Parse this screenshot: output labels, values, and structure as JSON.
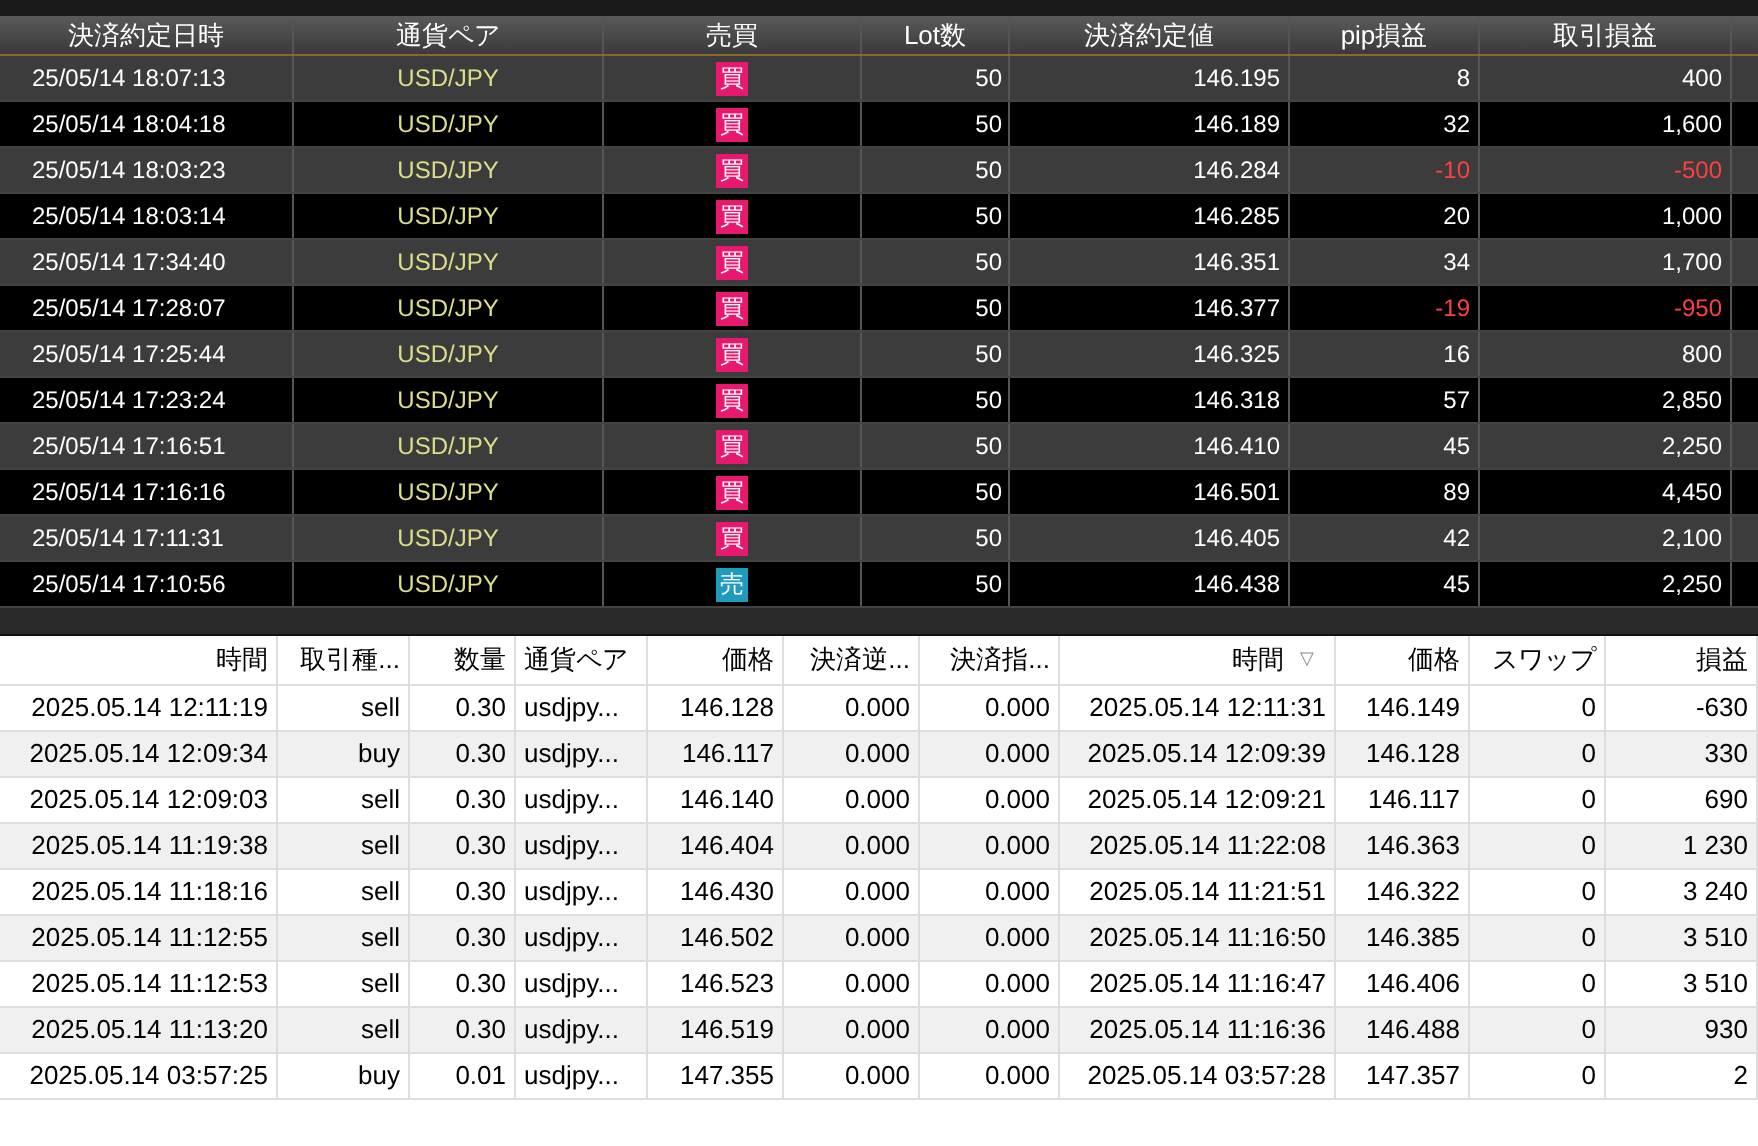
{
  "settlements": {
    "columns": [
      "決済約定日時",
      "通貨ペア",
      "売買",
      "Lot数",
      "決済約定値",
      "pip損益",
      "取引損益"
    ],
    "rows": [
      {
        "time": "25/05/14 18:07:13",
        "pair": "USD/JPY",
        "side": {
          "kind": "buy",
          "label": "買"
        },
        "lots": "50",
        "price": "146.195",
        "pips": "8",
        "profit": "400",
        "loss": false
      },
      {
        "time": "25/05/14 18:04:18",
        "pair": "USD/JPY",
        "side": {
          "kind": "buy",
          "label": "買"
        },
        "lots": "50",
        "price": "146.189",
        "pips": "32",
        "profit": "1,600",
        "loss": false
      },
      {
        "time": "25/05/14 18:03:23",
        "pair": "USD/JPY",
        "side": {
          "kind": "buy",
          "label": "買"
        },
        "lots": "50",
        "price": "146.284",
        "pips": "-10",
        "profit": "-500",
        "loss": true
      },
      {
        "time": "25/05/14 18:03:14",
        "pair": "USD/JPY",
        "side": {
          "kind": "buy",
          "label": "買"
        },
        "lots": "50",
        "price": "146.285",
        "pips": "20",
        "profit": "1,000",
        "loss": false
      },
      {
        "time": "25/05/14 17:34:40",
        "pair": "USD/JPY",
        "side": {
          "kind": "buy",
          "label": "買"
        },
        "lots": "50",
        "price": "146.351",
        "pips": "34",
        "profit": "1,700",
        "loss": false
      },
      {
        "time": "25/05/14 17:28:07",
        "pair": "USD/JPY",
        "side": {
          "kind": "buy",
          "label": "買"
        },
        "lots": "50",
        "price": "146.377",
        "pips": "-19",
        "profit": "-950",
        "loss": true
      },
      {
        "time": "25/05/14 17:25:44",
        "pair": "USD/JPY",
        "side": {
          "kind": "buy",
          "label": "買"
        },
        "lots": "50",
        "price": "146.325",
        "pips": "16",
        "profit": "800",
        "loss": false
      },
      {
        "time": "25/05/14 17:23:24",
        "pair": "USD/JPY",
        "side": {
          "kind": "buy",
          "label": "買"
        },
        "lots": "50",
        "price": "146.318",
        "pips": "57",
        "profit": "2,850",
        "loss": false
      },
      {
        "time": "25/05/14 17:16:51",
        "pair": "USD/JPY",
        "side": {
          "kind": "buy",
          "label": "買"
        },
        "lots": "50",
        "price": "146.410",
        "pips": "45",
        "profit": "2,250",
        "loss": false
      },
      {
        "time": "25/05/14 17:16:16",
        "pair": "USD/JPY",
        "side": {
          "kind": "buy",
          "label": "買"
        },
        "lots": "50",
        "price": "146.501",
        "pips": "89",
        "profit": "4,450",
        "loss": false
      },
      {
        "time": "25/05/14 17:11:31",
        "pair": "USD/JPY",
        "side": {
          "kind": "buy",
          "label": "買"
        },
        "lots": "50",
        "price": "146.405",
        "pips": "42",
        "profit": "2,100",
        "loss": false
      },
      {
        "time": "25/05/14 17:10:56",
        "pair": "USD/JPY",
        "side": {
          "kind": "sell",
          "label": "売"
        },
        "lots": "50",
        "price": "146.438",
        "pips": "45",
        "profit": "2,250",
        "loss": false
      }
    ]
  },
  "history": {
    "columns": [
      {
        "label": "時間"
      },
      {
        "label": "取引種..."
      },
      {
        "label": "数量"
      },
      {
        "label": "通貨ペア"
      },
      {
        "label": "価格"
      },
      {
        "label": "決済逆..."
      },
      {
        "label": "決済指..."
      },
      {
        "label": "時間",
        "sort": "▽"
      },
      {
        "label": "価格"
      },
      {
        "label": "スワップ"
      },
      {
        "label": "損益"
      }
    ],
    "rows": [
      [
        "2025.05.14 12:11:19",
        "sell",
        "0.30",
        "usdjpy...",
        "146.128",
        "0.000",
        "0.000",
        "2025.05.14 12:11:31",
        "146.149",
        "0",
        "-630"
      ],
      [
        "2025.05.14 12:09:34",
        "buy",
        "0.30",
        "usdjpy...",
        "146.117",
        "0.000",
        "0.000",
        "2025.05.14 12:09:39",
        "146.128",
        "0",
        "330"
      ],
      [
        "2025.05.14 12:09:03",
        "sell",
        "0.30",
        "usdjpy...",
        "146.140",
        "0.000",
        "0.000",
        "2025.05.14 12:09:21",
        "146.117",
        "0",
        "690"
      ],
      [
        "2025.05.14 11:19:38",
        "sell",
        "0.30",
        "usdjpy...",
        "146.404",
        "0.000",
        "0.000",
        "2025.05.14 11:22:08",
        "146.363",
        "0",
        "1 230"
      ],
      [
        "2025.05.14 11:18:16",
        "sell",
        "0.30",
        "usdjpy...",
        "146.430",
        "0.000",
        "0.000",
        "2025.05.14 11:21:51",
        "146.322",
        "0",
        "3 240"
      ],
      [
        "2025.05.14 11:12:55",
        "sell",
        "0.30",
        "usdjpy...",
        "146.502",
        "0.000",
        "0.000",
        "2025.05.14 11:16:50",
        "146.385",
        "0",
        "3 510"
      ],
      [
        "2025.05.14 11:12:53",
        "sell",
        "0.30",
        "usdjpy...",
        "146.523",
        "0.000",
        "0.000",
        "2025.05.14 11:16:47",
        "146.406",
        "0",
        "3 510"
      ],
      [
        "2025.05.14 11:13:20",
        "sell",
        "0.30",
        "usdjpy...",
        "146.519",
        "0.000",
        "0.000",
        "2025.05.14 11:16:36",
        "146.488",
        "0",
        "930"
      ],
      [
        "2025.05.14 03:57:25",
        "buy",
        "0.01",
        "usdjpy...",
        "147.355",
        "0.000",
        "0.000",
        "2025.05.14 03:57:28",
        "147.357",
        "0",
        "2"
      ]
    ]
  }
}
